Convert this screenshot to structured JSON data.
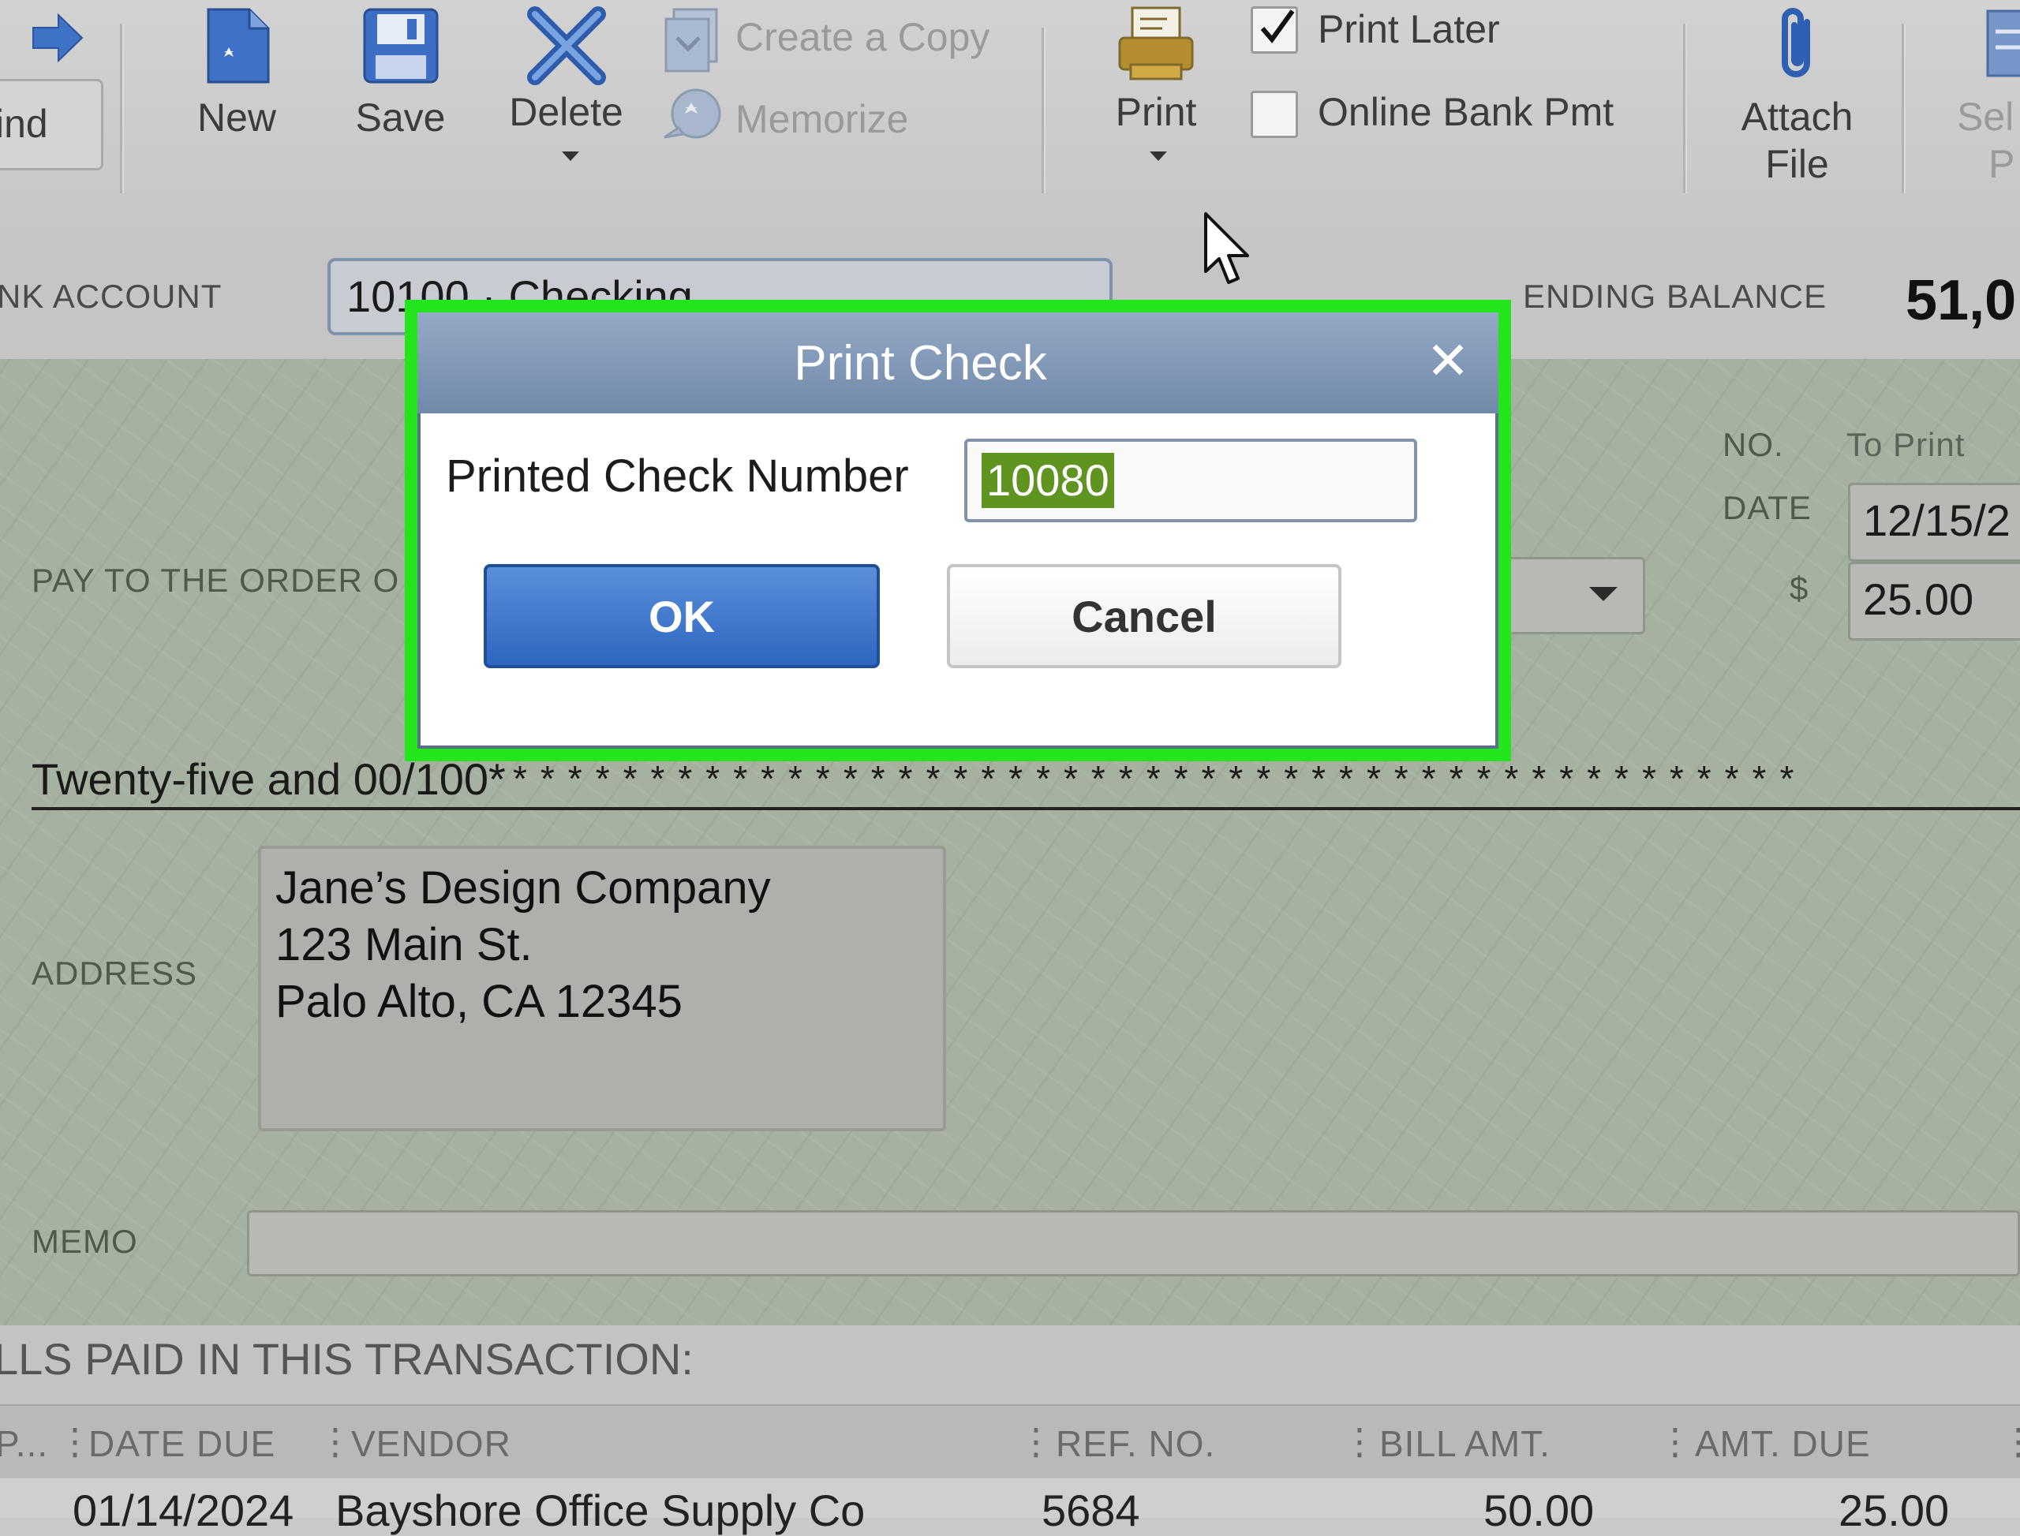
{
  "toolbar": {
    "find_label": "ind",
    "new_label": "New",
    "save_label": "Save",
    "delete_label": "Delete",
    "create_copy_label": "Create a Copy",
    "memorize_label": "Memorize",
    "print_label": "Print",
    "print_later_label": "Print Later",
    "print_later_checked": true,
    "online_bank_pmt_label": "Online Bank Pmt",
    "attach_file_label_1": "Attach",
    "attach_file_label_2": "File",
    "select_po_label_1": "Sel",
    "select_po_label_2": "P"
  },
  "account_bar": {
    "bank_account_label": "NK ACCOUNT",
    "bank_account_value": "10100 · Checking",
    "ending_balance_label": "ENDING BALANCE",
    "ending_balance_value": "51,0"
  },
  "check": {
    "no_label": "NO.",
    "no_value": "To Print",
    "date_label": "DATE",
    "date_value": "12/15/2",
    "dollar_label": "$",
    "amount_value": "25.00",
    "pay_to_label": "PAY TO THE ORDER O",
    "amount_words": "Twenty-five and 00/100*",
    "stars": "***********************************************",
    "address_label": "ADDRESS",
    "address_line_1": "Jane’s Design Company",
    "address_line_2": "123 Main St.",
    "address_line_3": "Palo Alto, CA 12345",
    "memo_label": "MEMO"
  },
  "bills": {
    "title": "LLS PAID IN THIS TRANSACTION:",
    "columns": [
      "P...",
      "DATE DUE",
      "VENDOR",
      "REF. NO.",
      "BILL AMT.",
      "AMT. DUE"
    ],
    "rows": [
      [
        "",
        "01/14/2024",
        "Bayshore Office Supply Co",
        "5684",
        "50.00",
        "25.00"
      ]
    ]
  },
  "dialog": {
    "title": "Print Check",
    "close_glyph": "✕",
    "field_label": "Printed Check Number",
    "field_value": "10080",
    "ok_label": "OK",
    "cancel_label": "Cancel"
  },
  "colors": {
    "highlight": "#23e51c",
    "ok_button": "#2e67c1",
    "title_bar": "#7189aa",
    "check_background": "#a6b1a1",
    "selection": "#5f9421"
  }
}
